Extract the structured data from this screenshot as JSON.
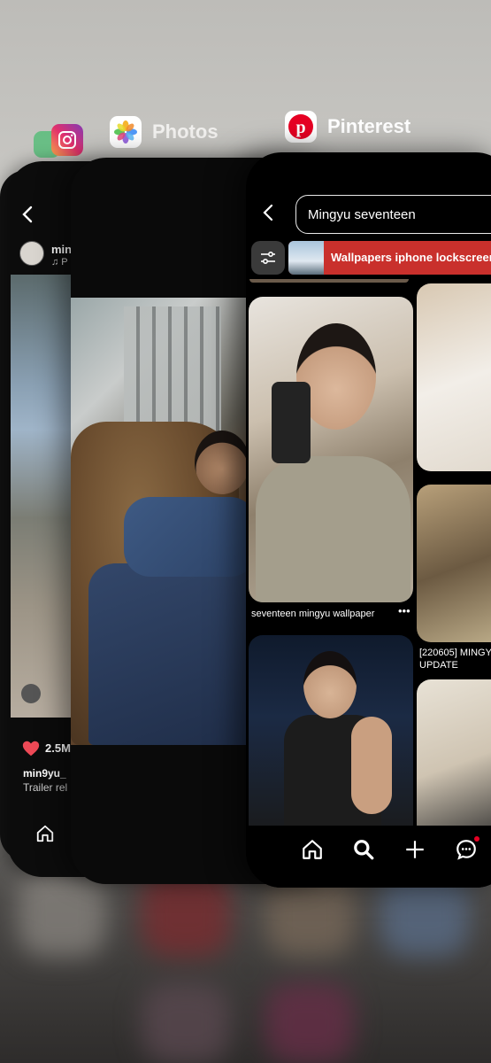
{
  "apps": {
    "instagram": {
      "label": "",
      "post": {
        "username": "min",
        "music": "♫ P",
        "likes": "2.5M",
        "caption_user": "min9yu_",
        "caption_text": "Trailer rel"
      },
      "icons": [
        "back-icon",
        "heart-icon",
        "home-icon",
        "person-icon"
      ]
    },
    "spotify": {
      "label": ""
    },
    "photos": {
      "label": "Photos"
    },
    "pinterest": {
      "label": "Pinterest",
      "search": {
        "value": "Mingyu seventeen"
      },
      "chip": {
        "label": "Wallpapers iphone lockscreen"
      },
      "pins": [
        {
          "caption": "seventeen mingyu wallpaper"
        },
        {
          "caption": "[220605] MINGY\nUPDATE"
        }
      ],
      "nav": [
        "home-icon",
        "search-icon",
        "create-icon",
        "messages-icon"
      ],
      "accent_color": "#e60023"
    }
  }
}
